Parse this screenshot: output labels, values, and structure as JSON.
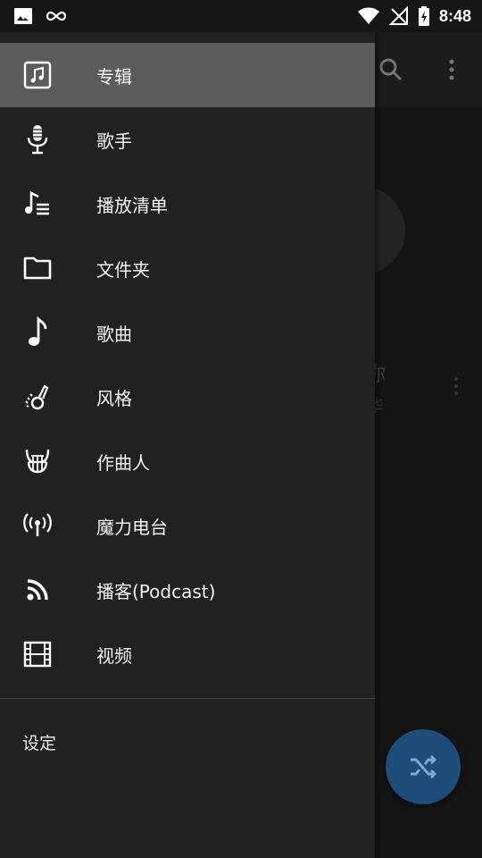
{
  "status_bar": {
    "time": "8:48",
    "icons_left": [
      "image-icon",
      "infinity-icon"
    ],
    "icons_right": [
      "wifi-icon",
      "no-signal-icon",
      "battery-charging-icon"
    ]
  },
  "drawer": {
    "items": [
      {
        "label": "专辑",
        "icon": "album-icon",
        "active": true
      },
      {
        "label": "歌手",
        "icon": "microphone-icon",
        "active": false
      },
      {
        "label": "播放清单",
        "icon": "playlist-icon",
        "active": false
      },
      {
        "label": "文件夹",
        "icon": "folder-icon",
        "active": false
      },
      {
        "label": "歌曲",
        "icon": "music-note-icon",
        "active": false
      },
      {
        "label": "风格",
        "icon": "genre-icon",
        "active": false
      },
      {
        "label": "作曲人",
        "icon": "lyre-icon",
        "active": false
      },
      {
        "label": "魔力电台",
        "icon": "radio-icon",
        "active": false
      },
      {
        "label": "播客(Podcast)",
        "icon": "rss-icon",
        "active": false
      },
      {
        "label": "视频",
        "icon": "film-icon",
        "active": false
      }
    ],
    "settings_label": "设定"
  },
  "background": {
    "item_title": "你",
    "item_subtitle": "华",
    "fab_icon": "shuffle-icon"
  },
  "colors": {
    "drawer_bg": "#212121",
    "active_item_bg": "#5c5c5c",
    "fab": "#1e4d7a"
  }
}
